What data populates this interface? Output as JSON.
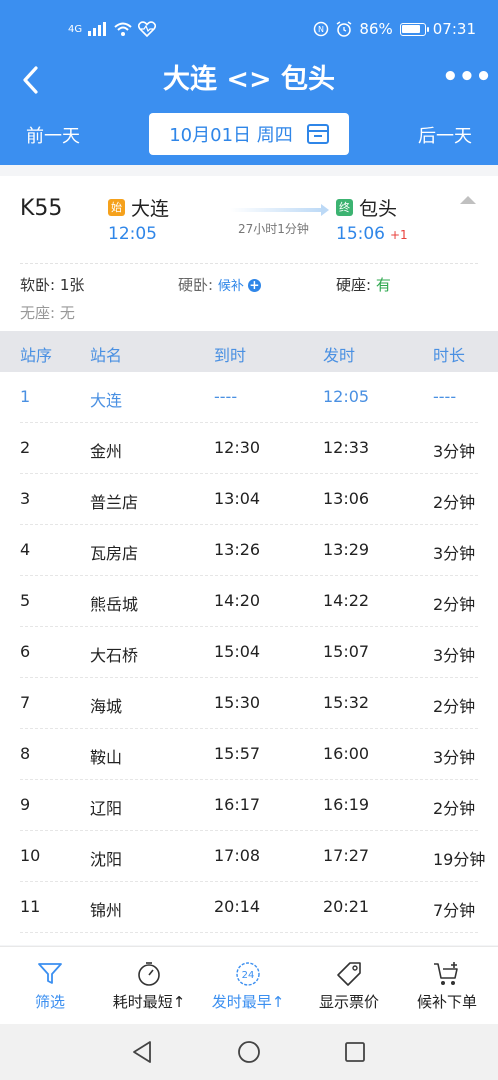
{
  "status_bar": {
    "network": "4G",
    "battery_pct_text": "86%",
    "battery_level": 0.86,
    "time": "07:31"
  },
  "nav": {
    "title": "大连 <> 包头",
    "more": "•••"
  },
  "date_bar": {
    "prev_label": "前一天",
    "date": "10月01日 周四",
    "next_label": "后一天"
  },
  "train": {
    "number": "K55",
    "from_tag": "始",
    "from_station": "大连",
    "from_time": "12:05",
    "to_tag": "终",
    "to_station": "包头",
    "to_time": "15:06",
    "day_offset": "+1",
    "duration": "27小时1分钟",
    "seats": {
      "soft_sleeper_label": "软卧:",
      "soft_sleeper_value": "1张",
      "hard_sleeper_label": "硬卧:",
      "hard_sleeper_value": "候补",
      "hard_seat_label": "硬座:",
      "hard_seat_value": "有",
      "no_seat_label": "无座:",
      "no_seat_value": "无"
    }
  },
  "table": {
    "headers": [
      "站序",
      "站名",
      "到时",
      "发时",
      "时长"
    ],
    "rows": [
      [
        "1",
        "大连",
        "----",
        "12:05",
        "----"
      ],
      [
        "2",
        "金州",
        "12:30",
        "12:33",
        "3分钟"
      ],
      [
        "3",
        "普兰店",
        "13:04",
        "13:06",
        "2分钟"
      ],
      [
        "4",
        "瓦房店",
        "13:26",
        "13:29",
        "3分钟"
      ],
      [
        "5",
        "熊岳城",
        "14:20",
        "14:22",
        "2分钟"
      ],
      [
        "6",
        "大石桥",
        "15:04",
        "15:07",
        "3分钟"
      ],
      [
        "7",
        "海城",
        "15:30",
        "15:32",
        "2分钟"
      ],
      [
        "8",
        "鞍山",
        "15:57",
        "16:00",
        "3分钟"
      ],
      [
        "9",
        "辽阳",
        "16:17",
        "16:19",
        "2分钟"
      ],
      [
        "10",
        "沈阳",
        "17:08",
        "17:27",
        "19分钟"
      ],
      [
        "11",
        "锦州",
        "20:14",
        "20:21",
        "7分钟"
      ]
    ]
  },
  "bottom_tabs": [
    {
      "label": "筛选",
      "icon": "filter-icon"
    },
    {
      "label": "耗时最短↑",
      "icon": "timer-icon"
    },
    {
      "label": "发时最早↑",
      "icon": "clock-24-icon",
      "icon_text": "24"
    },
    {
      "label": "显示票价",
      "icon": "price-tag-icon"
    },
    {
      "label": "候补下单",
      "icon": "cart-plus-icon"
    }
  ],
  "colors": {
    "primary": "#3b8ff0",
    "accent_text": "#2f86e8",
    "available": "#2fa84f",
    "day_offset": "#e8413c"
  }
}
